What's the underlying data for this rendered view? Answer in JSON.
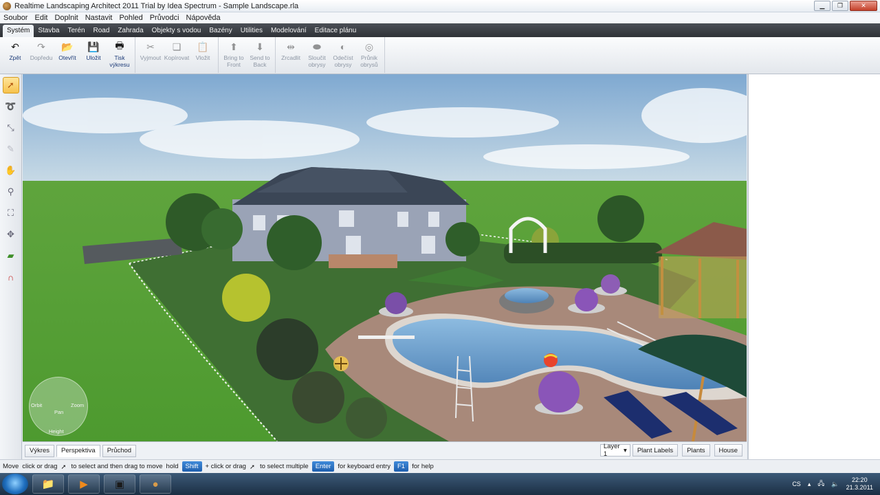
{
  "window": {
    "title": "Realtime Landscaping Architect 2011 Trial by Idea Spectrum - Sample Landscape.rla"
  },
  "menu": [
    "Soubor",
    "Edit",
    "Doplnit",
    "Nastavit",
    "Pohled",
    "Průvodci",
    "Nápověda"
  ],
  "ribbon_tabs": [
    "Systém",
    "Stavba",
    "Terén",
    "Road",
    "Zahrada",
    "Objekty s vodou",
    "Bazény",
    "Utilities",
    "Modelování",
    "Editace plánu"
  ],
  "toolbar": {
    "undo": "Zpět",
    "redo": "Dopředu",
    "open": "Otevřít",
    "save": "Uložit",
    "print": "Tisk\nvýkresu",
    "cut": "Vyjmout",
    "copy": "Kopírovat",
    "paste": "Vložit",
    "bring_front": "Bring to\nFront",
    "send_back": "Send to\nBack",
    "mirror": "Zrcadlit",
    "merge": "Sloučit\nobrysy",
    "subtract": "Odečíst\nobrysy",
    "intersect": "Průnik\nobrysů"
  },
  "nav": {
    "orbit": "Orbit",
    "pan": "Pan",
    "zoom": "Zoom",
    "height": "Height"
  },
  "view_tabs": [
    "Výkres",
    "Perspektiva",
    "Průchod"
  ],
  "view_right": {
    "layer": "Layer 1",
    "plant_labels": "Plant Labels",
    "plants": "Plants",
    "house": "House"
  },
  "status": {
    "move": "Move",
    "click_drag": "click or drag",
    "to_select": "to select and then drag to move",
    "hold": "hold",
    "shift": "Shift",
    "plus": "+ click or drag",
    "select_multiple": "to select multiple",
    "enter": "Enter",
    "keyboard": "for keyboard entry",
    "f1": "F1",
    "help": "for help"
  },
  "tray": {
    "lang": "CS",
    "time": "22:20",
    "date": "21.3.2011"
  },
  "colors": {
    "sky": "#8fb6d8",
    "lawn": "#5aa83a",
    "pool": "#5d93c6",
    "paving": "#a9897a",
    "roof": "#3b4656"
  }
}
